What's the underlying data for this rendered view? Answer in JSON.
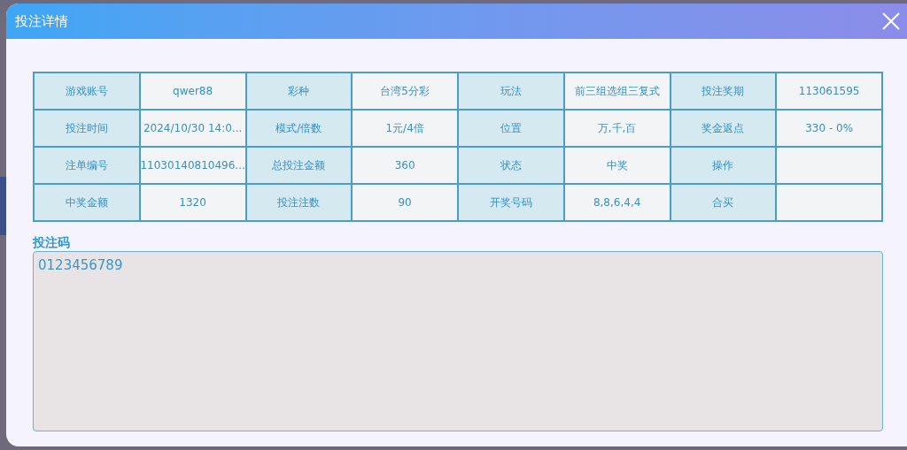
{
  "dialog": {
    "title": "投注详情"
  },
  "details": [
    [
      {
        "label": "游戏账号",
        "value": "qwer88"
      },
      {
        "label": "彩种",
        "value": "台湾5分彩"
      },
      {
        "label": "玩法",
        "value": "前三组选组三复式"
      },
      {
        "label": "投注奖期",
        "value": "113061595"
      }
    ],
    [
      {
        "label": "投注时间",
        "value": "2024/10/30 14:0..."
      },
      {
        "label": "模式/倍数",
        "value": "1元/4倍"
      },
      {
        "label": "位置",
        "value": "万,千,百"
      },
      {
        "label": "奖金返点",
        "value": "330 - 0%"
      }
    ],
    [
      {
        "label": "注单编号",
        "value": "11030140810496..."
      },
      {
        "label": "总投注金额",
        "value": "360"
      },
      {
        "label": "状态",
        "value": "中奖"
      },
      {
        "label": "操作"
      }
    ],
    [
      {
        "label": "中奖金额",
        "value": "1320"
      },
      {
        "label": "投注注数",
        "value": "90"
      },
      {
        "label": "开奖号码",
        "value": "8,8,6,4,4"
      },
      {
        "label": "合买"
      }
    ]
  ],
  "bet_code": {
    "label": "投注码",
    "value": "0123456789"
  }
}
